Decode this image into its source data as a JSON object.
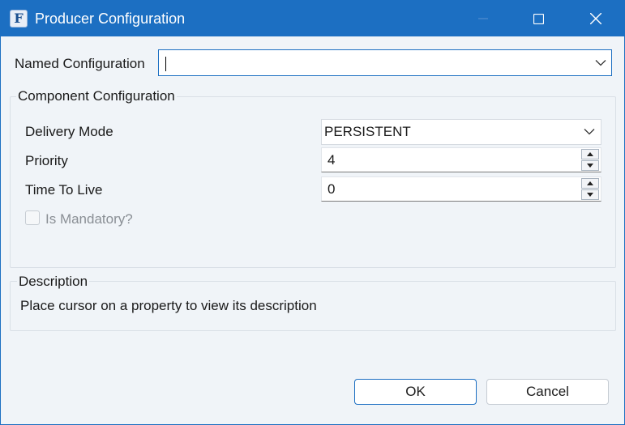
{
  "window": {
    "title": "Producer Configuration",
    "app_icon": "F",
    "controls": {
      "minimize": "minimize-icon",
      "maximize": "maximize-icon",
      "close": "close-icon"
    }
  },
  "named_configuration": {
    "label": "Named Configuration",
    "value": ""
  },
  "component_configuration": {
    "title": "Component Configuration",
    "delivery_mode": {
      "label": "Delivery Mode",
      "value": "PERSISTENT"
    },
    "priority": {
      "label": "Priority",
      "value": "4"
    },
    "time_to_live": {
      "label": "Time To Live",
      "value": "0"
    },
    "is_mandatory": {
      "label": "Is Mandatory?",
      "checked": false,
      "enabled": false
    }
  },
  "description": {
    "title": "Description",
    "text": "Place cursor on a property to view its description"
  },
  "buttons": {
    "ok": "OK",
    "cancel": "Cancel"
  },
  "colors": {
    "titlebar": "#1c6fc2",
    "background": "#f0f4f8",
    "accent": "#1c6fc2"
  }
}
